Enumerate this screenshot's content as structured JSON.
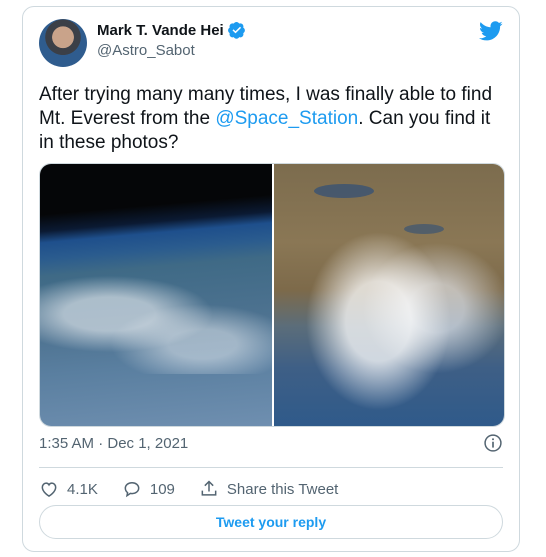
{
  "author": {
    "display_name": "Mark T. Vande Hei",
    "handle": "@Astro_Sabot",
    "verified": true
  },
  "icons": {
    "brand": "twitter-bird-icon",
    "verified": "verified-badge-icon",
    "info": "info-icon",
    "like": "heart-icon",
    "reply": "reply-bubble-icon",
    "share": "share-icon"
  },
  "tweet": {
    "text_before": "After trying many many times, I was finally able to find Mt. Everest from the ",
    "mention": "@Space_Station",
    "text_after": ". Can you find it in these photos?",
    "timestamp": "1:35 AM · Dec 1, 2021"
  },
  "actions": {
    "likes": "4.1K",
    "replies": "109",
    "share_label": "Share this Tweet"
  },
  "reply_button": "Tweet your reply",
  "colors": {
    "accent": "#1d9bf0",
    "text": "#0f1419",
    "muted": "#536471",
    "border": "#cfd9de"
  }
}
